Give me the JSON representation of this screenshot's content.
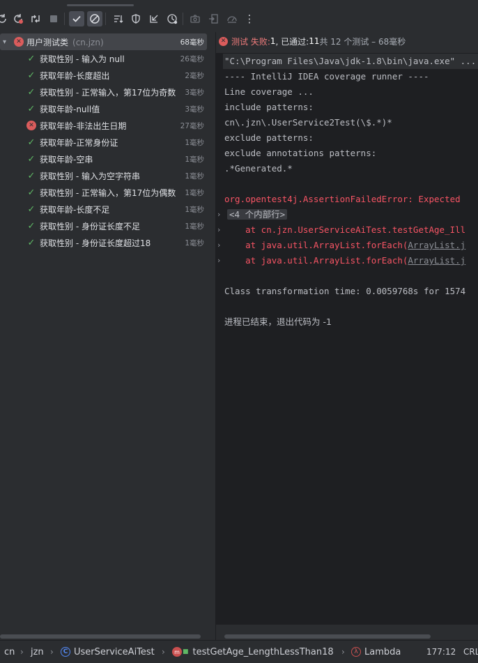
{
  "toolbar": {
    "icons": [
      "rerun-icon",
      "rerun-failed-icon",
      "toggle-auto-test-icon",
      "stop-icon",
      "show-passed-icon",
      "show-ignored-icon",
      "sort-icon",
      "coverage-icon",
      "collapse-icon",
      "history-icon",
      "camera-icon",
      "import-icon",
      "export-icon",
      "more-icon"
    ],
    "more_label": "⋮"
  },
  "test_tree": {
    "root": {
      "name": "用户测试类",
      "package": "(cn.jzn)",
      "duration": "68毫秒",
      "status": "fail"
    },
    "items": [
      {
        "name": "获取性别 - 输入为 null",
        "duration": "26毫秒",
        "status": "pass"
      },
      {
        "name": "获取年龄-长度超出",
        "duration": "2毫秒",
        "status": "pass"
      },
      {
        "name": "获取性别 - 正常输入，第17位为奇数",
        "duration": "3毫秒",
        "status": "pass"
      },
      {
        "name": "获取年龄-null值",
        "duration": "3毫秒",
        "status": "pass"
      },
      {
        "name": "获取年龄-非法出生日期",
        "duration": "27毫秒",
        "status": "fail"
      },
      {
        "name": "获取年龄-正常身份证",
        "duration": "1毫秒",
        "status": "pass"
      },
      {
        "name": "获取年龄-空串",
        "duration": "1毫秒",
        "status": "pass"
      },
      {
        "name": "获取性别 - 输入为空字符串",
        "duration": "1毫秒",
        "status": "pass"
      },
      {
        "name": "获取性别 - 正常输入，第17位为偶数",
        "duration": "1毫秒",
        "status": "pass"
      },
      {
        "name": "获取年龄-长度不足",
        "duration": "1毫秒",
        "status": "pass"
      },
      {
        "name": "获取性别 - 身份证长度不足",
        "duration": "1毫秒",
        "status": "pass"
      },
      {
        "name": "获取性别 - 身份证长度超过18",
        "duration": "1毫秒",
        "status": "pass"
      }
    ]
  },
  "status_bar": {
    "failed_label": "测试 失败: ",
    "failed_count": "1",
    "passed_label": ", 已通过: ",
    "passed_count": "11",
    "total_text": "共 12 个测试 – 68毫秒"
  },
  "console": {
    "cmd": "\"C:\\Program Files\\Java\\jdk-1.8\\bin\\java.exe\" ...",
    "lines": [
      "---- IntelliJ IDEA coverage runner ----",
      "Line coverage ...",
      "include patterns:",
      "cn\\.jzn\\.UserService2Test(\\$.*)*",
      "exclude patterns:",
      "exclude annotations patterns:",
      ".*Generated.*"
    ],
    "error_line": "org.opentest4j.AssertionFailedError: Expected",
    "fold_text": "<4 个内部行>",
    "stack": [
      {
        "prefix": "    at cn.jzn.UserServiceAiTest.testGetAge_Ill",
        "link": ""
      },
      {
        "prefix": "    at java.util.ArrayList.forEach(",
        "link": "ArrayList.j"
      },
      {
        "prefix": "    at java.util.ArrayList.forEach(",
        "link": "ArrayList.j"
      }
    ],
    "transform_line": "Class transformation time: 0.0059768s for 1574",
    "exit_line": "进程已结束，退出代码为 -1"
  },
  "breadcrumb": {
    "items": [
      "cn",
      "jzn",
      "UserServiceAiTest",
      "testGetAge_LengthLessThan18",
      "Lambda"
    ],
    "position": "177:12",
    "line_sep": "CRL"
  }
}
